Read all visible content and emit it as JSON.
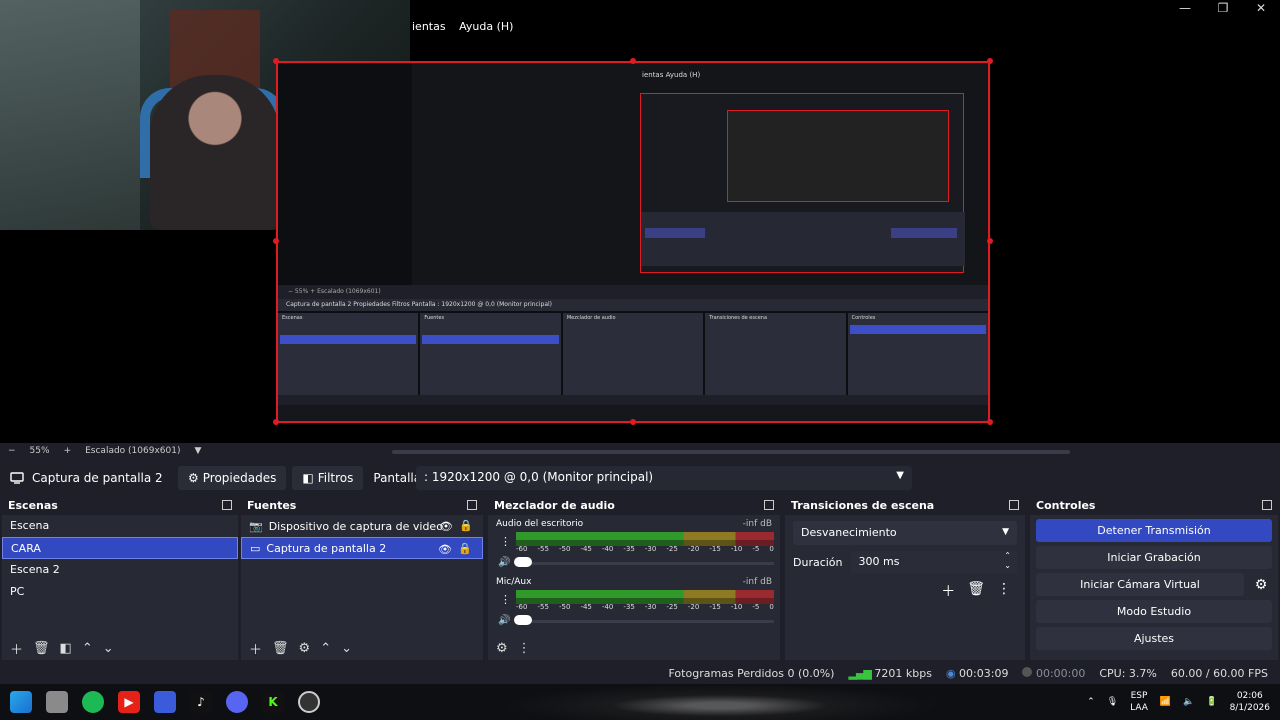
{
  "window": {
    "menu_items": [
      "ientas",
      "Ayuda (H)"
    ],
    "controls": [
      "—",
      "❐",
      "✕"
    ]
  },
  "zoom_bar": {
    "minus": "−",
    "zoom": "55%",
    "plus": "+",
    "mode": "Escalado (1069x601)",
    "caret": "▼"
  },
  "source_toolbar": {
    "source_name": "Captura de pantalla 2",
    "properties_label": "Propiedades",
    "filters_label": "Filtros",
    "display_label": "Pantalla",
    "display_value": ": 1920x1200 @ 0,0 (Monitor principal)"
  },
  "scenes": {
    "title": "Escenas",
    "items": [
      "Escena",
      "CARA",
      "Escena 2",
      "PC"
    ],
    "selected_index": 1
  },
  "sources": {
    "title": "Fuentes",
    "items": [
      "Dispositivo de captura de video",
      "Captura de pantalla 2"
    ],
    "selected_index": 1
  },
  "mixer": {
    "title": "Mezclador de audio",
    "channels": [
      {
        "name": "Audio del escritorio",
        "db": "-inf dB"
      },
      {
        "name": "Mic/Aux",
        "db": "-inf dB"
      }
    ],
    "ticks": [
      "-60",
      "-55",
      "-50",
      "-45",
      "-40",
      "-35",
      "-30",
      "-25",
      "-20",
      "-15",
      "-10",
      "-5",
      "0"
    ]
  },
  "transitions": {
    "title": "Transiciones de escena",
    "selected": "Desvanecimiento",
    "duration_label": "Duración",
    "duration_value": "300 ms"
  },
  "controls": {
    "title": "Controles",
    "stop_stream": "Detener Transmisión",
    "start_recording": "Iniciar Grabación",
    "start_virtual_cam": "Iniciar Cámara Virtual",
    "studio_mode": "Modo Estudio",
    "settings": "Ajustes"
  },
  "status": {
    "dropped_frames": "Fotogramas Perdidos 0 (0.0%)",
    "bitrate": "7201 kbps",
    "stream_time": "00:03:09",
    "rec_time": "00:00:00",
    "cpu": "CPU: 3.7%",
    "fps": "60.00 / 60.00 FPS"
  },
  "capture_preview": {
    "menu": "ientas   Ayuda (H)",
    "zoom": "−   55%   +   Escalado (1069x601)",
    "source": "Captura de pantalla 2     Propiedades     Filtros     Pantalla   : 1920x1200 @ 0,0 (Monitor principal)",
    "dock_titles": [
      "Escenas",
      "Fuentes",
      "Mezclador de audio",
      "Transiciones de escena",
      "Controles"
    ]
  },
  "taskbar": {
    "lang_top": "ESP",
    "lang_bottom": "LAA",
    "time": "02:06",
    "date": "8/1/2026"
  },
  "colors": {
    "accent": "#3249c2",
    "bg": "#1e1f29",
    "panel": "#272934",
    "red_border": "#e01b24",
    "meter_green": "#2f9a2a"
  }
}
